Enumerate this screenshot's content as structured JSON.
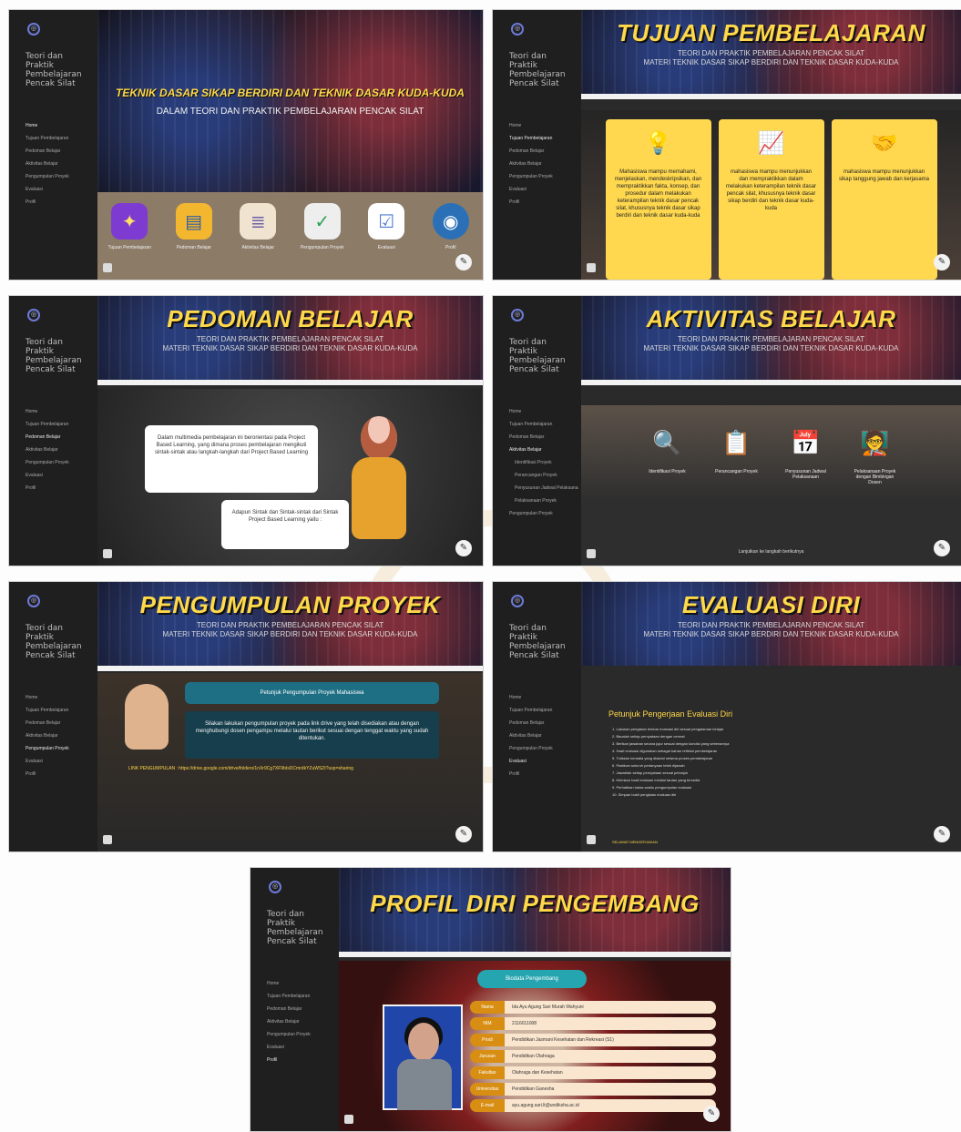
{
  "site": {
    "title_lines": [
      "Teori dan",
      "Praktik",
      "Pembelajaran",
      "Pencak Silat"
    ]
  },
  "sidebar_labels": [
    "Home",
    "Tujuan Pembelajaran",
    "Pedoman Belajar",
    "Aktivitas Belajar",
    "Pengumpulan Proyek",
    "Evaluasi",
    "Profil",
    "Identifikasi Proyek",
    "Perancangan Proyek",
    "Penyusunan Jadwal Pelaksanaan",
    "Pelaksanaan Proyek",
    "Pengumpulan Proyek"
  ],
  "screens": {
    "s1": {
      "hero_title": "TEKNIK DASAR SIKAP BERDIRI DAN TEKNIK DASAR KUDA-KUDA",
      "hero_subtitle": "DALAM TEORI DAN PRAKTIK PEMBELAJARAN PENCAK SILAT",
      "menu": [
        {
          "label": "Tujuan Pembelajaran",
          "icon": "idea-icon"
        },
        {
          "label": "Pedoman Belajar",
          "icon": "book-icon"
        },
        {
          "label": "Aktivitas Belajar",
          "icon": "stack-books-icon"
        },
        {
          "label": "Pengumpulan Proyek",
          "icon": "document-check-icon"
        },
        {
          "label": "Evaluasi",
          "icon": "checklist-icon"
        },
        {
          "label": "Profil",
          "icon": "profile-icon"
        }
      ]
    },
    "s2": {
      "title": "TUJUAN PEMBELAJARAN",
      "subtitle1": "TEORI DAN PRAKTIK PEMBELAJARAN PENCAK SILAT",
      "subtitle2": "MATERI TEKNIK DASAR SIKAP BERDIRI DAN TEKNIK DASAR KUDA-KUDA",
      "cards": [
        "Mahasiswa mampu memahami, menjelaskan, mendeskripsikan, dan mempraktikkan fakta, konsep, dan prosedur dalam melakukan keterampilan teknik dasar pencak silat, khususnya teknik dasar sikap berdiri dan teknik dasar kuda-kuda",
        "mahasiswa mampu menunjukkan dan mempraktikkan dalam melakukan keterampilan teknik dasar pencak silat, khususnya teknik dasar sikap berdiri dan teknik dasar kuda-kuda",
        "mahasiswa mampu menunjukkan sikap tanggung jawab dan kerjasama"
      ]
    },
    "s3": {
      "title": "PEDOMAN BELAJAR",
      "subtitle1": "TEORI DAN PRAKTIK PEMBELAJARAN PENCAK SILAT",
      "subtitle2": "MATERI TEKNIK DASAR SIKAP BERDIRI DAN TEKNIK DASAR KUDA-KUDA",
      "bubble1": "Dalam multimedia pembelajaran ini berorientasi pada Project Based Learning, yang dimana proses pembelajaran mengikuti sintak-sintak atau langkah-langkah dari Project Based Learning",
      "bubble2": "Adapun Sintak dan Sintak-sintak dari Sintak Project Based Learning yaitu :"
    },
    "s4": {
      "title": "AKTIVITAS BELAJAR",
      "subtitle1": "TEORI DAN PRAKTIK PEMBELAJARAN PENCAK SILAT",
      "subtitle2": "MATERI TEKNIK DASAR SIKAP BERDIRI DAN TEKNIK DASAR KUDA-KUDA",
      "items": [
        {
          "label": "Identifikasi Proyek",
          "icon": "magnifier-icon"
        },
        {
          "label": "Perancangan Proyek",
          "icon": "clipboard-icon"
        },
        {
          "label": "Penyusunan Jadwal Pelaksanaan",
          "icon": "calendar-icon"
        },
        {
          "label": "Pelaksanaan Proyek dengan Bimbingan Dosen",
          "icon": "presentation-icon"
        }
      ],
      "footer": "Lanjutkan ke langkah berikutnya"
    },
    "s5": {
      "title": "PENGUMPULAN PROYEK",
      "subtitle1": "TEORI DAN PRAKTIK PEMBELAJARAN PENCAK SILAT",
      "subtitle2": "MATERI TEKNIK DASAR SIKAP BERDIRI DAN TEKNIK DASAR KUDA-KUDA",
      "panel_title": "Petunjuk Pengumpulan Proyek Mahasiswa",
      "panel_text": "Silakan lakukan pengumpulan proyek pada link drive yang telah disediakan atau dengan menghubungi dosen pengampu melalui tautan berikut sesuai dengan tenggat waktu yang sudah ditentukan.",
      "link_label": "LINK PENGUMPULAN :",
      "link_value": "https://drive.google.com/drive/folders/1nXr9Cg7XF9bIsDCmrdkYZuWSZt?usp=sharing"
    },
    "s6": {
      "title": "EVALUASI DIRI",
      "subtitle1": "TEORI DAN PRAKTIK PEMBELAJARAN PENCAK SILAT",
      "subtitle2": "MATERI TEKNIK DASAR SIKAP BERDIRI DAN TEKNIK DASAR KUDA-KUDA",
      "heading": "Petunjuk Pengerjaan Evaluasi Diri",
      "items": [
        "1. Lakukan pengisian lembar evaluasi diri sesuai pengalaman belajar",
        "2. Bacalah setiap pernyataan dengan cermat",
        "3. Berikan jawaban secara jujur sesuai dengan kondisi yang sebenarnya",
        "4. Hasil evaluasi digunakan sebagai bahan refleksi pembelajaran",
        "5. Tuliskan kendala yang dialami selama proses pembelajaran",
        "6. Pastikan seluruh pertanyaan telah dijawab",
        "7. Jawablah setiap pernyataan sesuai petunjuk",
        "8. Kirimkan hasil evaluasi melalui tautan yang tersedia",
        "9. Perhatikan batas waktu pengumpulan evaluasi",
        "10. Simpan bukti pengisian evaluasi diri"
      ],
      "footer": "SELAMAT MENGERJAKAN"
    },
    "s7": {
      "title": "PROFIL DIRI PENGEMBANG",
      "badge": "Biodata Pengembang",
      "labels": [
        "Nama",
        "NIM",
        "Prodi",
        "Jurusan",
        "Fakultas",
        "Universitas",
        "E-mail"
      ],
      "values": [
        "Ida Ayu Agung Sari Murah Wahyuni",
        "2116011008",
        "Pendidikan Jasmani Kesehatan dan Rekreasi (S1)",
        "Pendidikan Olahraga",
        "Olahraga dan Kesehatan",
        "Pendidikan Ganesha",
        "ayu.agung.sari.lt@undiksha.ac.id"
      ]
    }
  },
  "colors": {
    "accent": "#ffd94a",
    "sidebar": "#1f1f1f",
    "main": "#2a2a2a",
    "teal": "#25a5b0"
  }
}
